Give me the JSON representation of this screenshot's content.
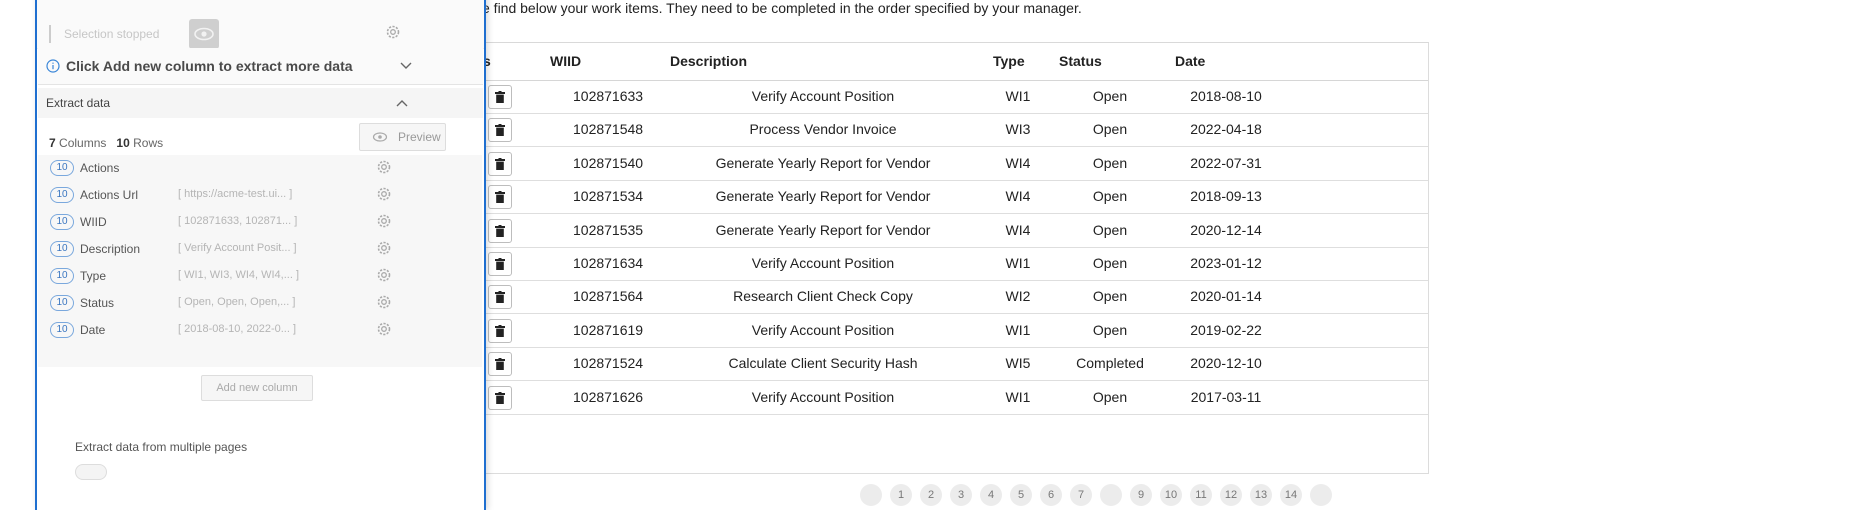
{
  "page": {
    "intro_text": "e find below your work items. They need to be completed in the order specified by your manager.",
    "table": {
      "headers": [
        "s",
        "WIID",
        "Description",
        "Type",
        "Status",
        "Date"
      ],
      "rows": [
        {
          "wiid": "102871633",
          "description": "Verify Account Position",
          "type": "WI1",
          "status": "Open",
          "date": "2018-08-10"
        },
        {
          "wiid": "102871548",
          "description": "Process Vendor Invoice",
          "type": "WI3",
          "status": "Open",
          "date": "2022-04-18"
        },
        {
          "wiid": "102871540",
          "description": "Generate Yearly Report for Vendor",
          "type": "WI4",
          "status": "Open",
          "date": "2022-07-31"
        },
        {
          "wiid": "102871534",
          "description": "Generate Yearly Report for Vendor",
          "type": "WI4",
          "status": "Open",
          "date": "2018-09-13"
        },
        {
          "wiid": "102871535",
          "description": "Generate Yearly Report for Vendor",
          "type": "WI4",
          "status": "Open",
          "date": "2020-12-14"
        },
        {
          "wiid": "102871634",
          "description": "Verify Account Position",
          "type": "WI1",
          "status": "Open",
          "date": "2023-01-12"
        },
        {
          "wiid": "102871564",
          "description": "Research Client Check Copy",
          "type": "WI2",
          "status": "Open",
          "date": "2020-01-14"
        },
        {
          "wiid": "102871619",
          "description": "Verify Account Position",
          "type": "WI1",
          "status": "Open",
          "date": "2019-02-22"
        },
        {
          "wiid": "102871524",
          "description": "Calculate Client Security Hash",
          "type": "WI5",
          "status": "Completed",
          "date": "2020-12-10"
        },
        {
          "wiid": "102871626",
          "description": "Verify Account Position",
          "type": "WI1",
          "status": "Open",
          "date": "2017-03-11"
        }
      ]
    },
    "pagination": [
      "",
      "1",
      "2",
      "3",
      "4",
      "5",
      "6",
      "7",
      "",
      "9",
      "10",
      "11",
      "12",
      "13",
      "14",
      ""
    ]
  },
  "panel": {
    "selection_status": "Selection stopped",
    "info_message": "Click Add new column to extract more data",
    "extract_section_title": "Extract data",
    "columns_count": "7",
    "columns_label": "Columns",
    "rows_count": "10",
    "rows_label": "Rows",
    "preview_label": "Preview",
    "columns": [
      {
        "badge": "10",
        "name": "Actions",
        "preview": ""
      },
      {
        "badge": "10",
        "name": "Actions Url",
        "preview": "[ https://acme-test.ui... ]"
      },
      {
        "badge": "10",
        "name": "WIID",
        "preview": "[ 102871633, 102871... ]"
      },
      {
        "badge": "10",
        "name": "Description",
        "preview": "[ Verify Account Posit... ]"
      },
      {
        "badge": "10",
        "name": "Type",
        "preview": "[ WI1, WI3, WI4, WI4,... ]"
      },
      {
        "badge": "10",
        "name": "Status",
        "preview": "[ Open, Open, Open,... ]"
      },
      {
        "badge": "10",
        "name": "Date",
        "preview": "[ 2018-08-10, 2022-0... ]"
      }
    ],
    "add_column_label": "Add new column",
    "multi_page_label": "Extract data from multiple pages"
  },
  "colors": {
    "accent": "#1f6fd0",
    "badge_border": "#7aa8dd"
  }
}
